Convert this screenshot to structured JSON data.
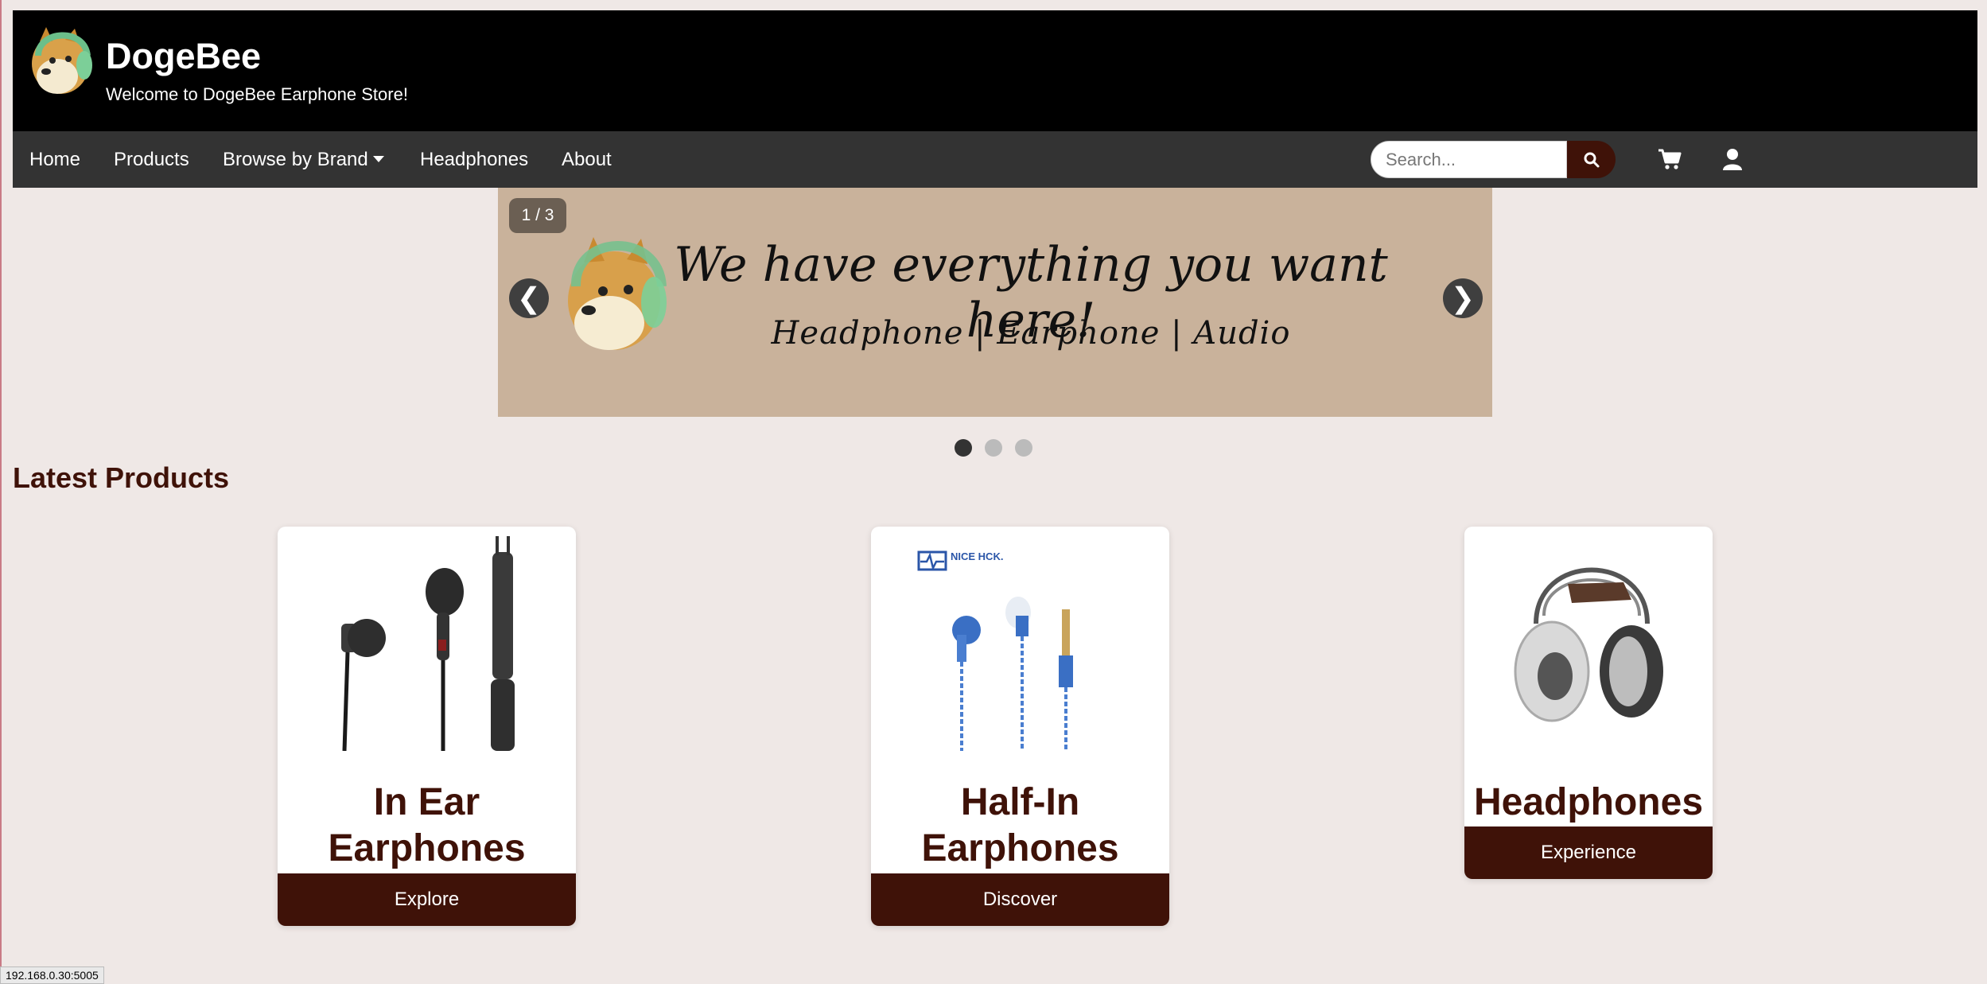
{
  "header": {
    "title": "DogeBee",
    "subtitle": "Welcome to DogeBee Earphone Store!"
  },
  "nav": {
    "items": [
      "Home",
      "Products",
      "Browse by Brand",
      "Headphones",
      "About"
    ],
    "search_placeholder": "Search...",
    "icons": [
      "search-icon",
      "cart-icon",
      "user-icon"
    ]
  },
  "carousel": {
    "counter": "1 / 3",
    "prev": "❮",
    "next": "❯",
    "headline": "We have everything you want here!",
    "sub": "Headphone | Earphone | Audio",
    "dots": 3,
    "active_dot": 0
  },
  "latest": {
    "title": "Latest Products",
    "cards": [
      {
        "title_line1": "In Ear",
        "title_line2": "Earphones",
        "button": "Explore"
      },
      {
        "title_line1": "Half-In",
        "title_line2": "Earphones",
        "button": "Discover",
        "brand": "NICE HCK."
      },
      {
        "title_line1": "Headphones",
        "button": "Experience"
      }
    ]
  },
  "status_bar": "192.168.0.30:5005",
  "colors": {
    "accent": "#3f1208",
    "header_bg": "#000000",
    "nav_bg": "#333333",
    "page_bg": "#efe8e6",
    "carousel_bg": "#c9b29b"
  }
}
